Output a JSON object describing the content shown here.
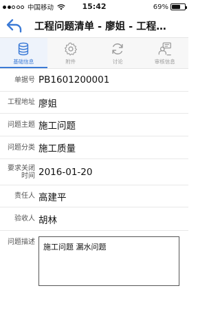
{
  "status_bar": {
    "carrier": "中国移动",
    "time": "15:42",
    "battery_percent": "69%",
    "battery_level": 0.69
  },
  "nav": {
    "title": "工程问题清单 - 廖姐 - 工程…"
  },
  "tabs": [
    {
      "label": "基础信息",
      "icon": "database-icon",
      "active": true
    },
    {
      "label": "附件",
      "icon": "gear-icon",
      "active": false
    },
    {
      "label": "讨论",
      "icon": "refresh-icon",
      "active": false
    },
    {
      "label": "审核信息",
      "icon": "reviewer-icon",
      "active": false
    }
  ],
  "form": {
    "order_no": {
      "label": "单据号",
      "value": "PB1601200001"
    },
    "site_address": {
      "label": "工程地址",
      "value": "廖姐"
    },
    "subject": {
      "label": "问题主题",
      "value": "施工问题"
    },
    "category": {
      "label": "问题分类",
      "value": "施工质量"
    },
    "deadline": {
      "label_line1": "要求关闭",
      "label_line2": "时间",
      "value": "2016-01-20"
    },
    "owner": {
      "label": "责任人",
      "value": "高建平"
    },
    "acceptor": {
      "label": "验收人",
      "value": "胡林"
    },
    "description": {
      "label": "问题描述",
      "value": "施工问题 漏水问题"
    }
  },
  "colors": {
    "accent": "#3b7ad6",
    "inactive": "#9b9b9b"
  }
}
